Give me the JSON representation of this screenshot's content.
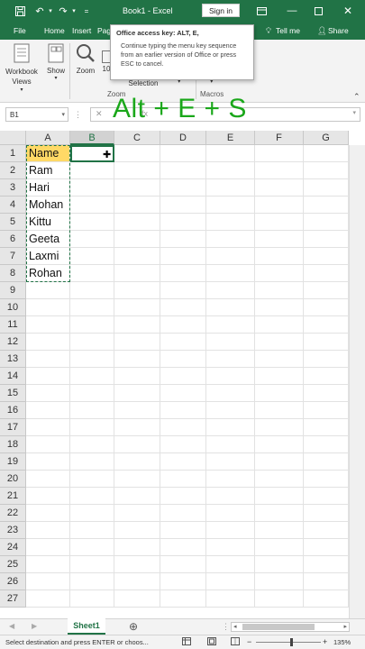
{
  "window": {
    "title": "Book1  -  Excel",
    "sign_in": "Sign in"
  },
  "tabs": [
    "File",
    "Home",
    "Insert",
    "Pag"
  ],
  "tell_me": "Tell me",
  "share": "Share",
  "ribbon": {
    "workbook_views": "Workbook Views",
    "show": "Show",
    "zoom": "Zoom",
    "zoom_100": "10",
    "zoom_group": "Zoom",
    "selection": "Selection",
    "macros": "Macros"
  },
  "tooltip": {
    "title": "Office access key: ALT, E,",
    "body": "Continue typing the menu key sequence from an earlier version of Office or press ESC to cancel."
  },
  "formula_bar": {
    "name_box": "B1",
    "fx": "fx",
    "value": ""
  },
  "overlay_text": "Alt + E + S",
  "columns": [
    "A",
    "B",
    "C",
    "D",
    "E",
    "F",
    "G"
  ],
  "rows": [
    "1",
    "2",
    "3",
    "4",
    "5",
    "6",
    "7",
    "8",
    "9",
    "10",
    "11",
    "12",
    "13",
    "14",
    "15",
    "16",
    "17",
    "18",
    "19",
    "20",
    "21",
    "22",
    "23",
    "24",
    "25",
    "26",
    "27"
  ],
  "cells_a": [
    "Name",
    "Ram",
    "Hari",
    "Mohan",
    "Kittu",
    "Geeta",
    "Laxmi",
    "Rohan"
  ],
  "header_fill": "#ffd966",
  "sheet_tab": "Sheet1",
  "status_text": "Select destination and press ENTER or choos...",
  "zoom_level": "135%",
  "colors": {
    "accent": "#217346",
    "overlay": "#1aa71a"
  }
}
